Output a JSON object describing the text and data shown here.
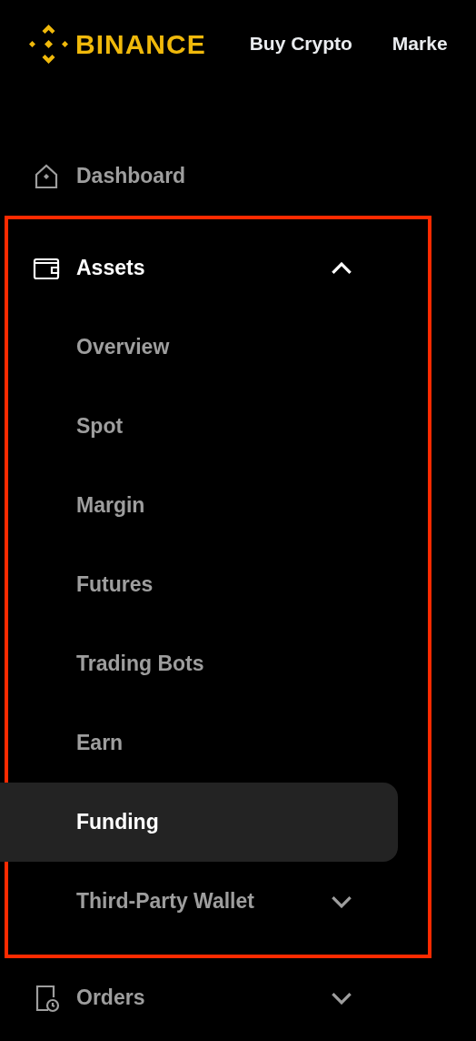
{
  "header": {
    "logo": "BINANCE",
    "nav": [
      "Buy Crypto",
      "Marke"
    ]
  },
  "sidebar": {
    "items": [
      {
        "label": "Dashboard",
        "kind": "link"
      },
      {
        "label": "Assets",
        "kind": "group",
        "expanded": true,
        "highlighted": true,
        "children": [
          {
            "label": "Overview",
            "kind": "link",
            "selected": false
          },
          {
            "label": "Spot",
            "kind": "link",
            "selected": false
          },
          {
            "label": "Margin",
            "kind": "link",
            "selected": false
          },
          {
            "label": "Futures",
            "kind": "link",
            "selected": false
          },
          {
            "label": "Trading Bots",
            "kind": "link",
            "selected": false
          },
          {
            "label": "Earn",
            "kind": "link",
            "selected": false
          },
          {
            "label": "Funding",
            "kind": "link",
            "selected": true
          },
          {
            "label": "Third-Party Wallet",
            "kind": "group",
            "expanded": false,
            "selected": false
          }
        ]
      },
      {
        "label": "Orders",
        "kind": "group",
        "expanded": false,
        "highlighted": false
      }
    ]
  }
}
